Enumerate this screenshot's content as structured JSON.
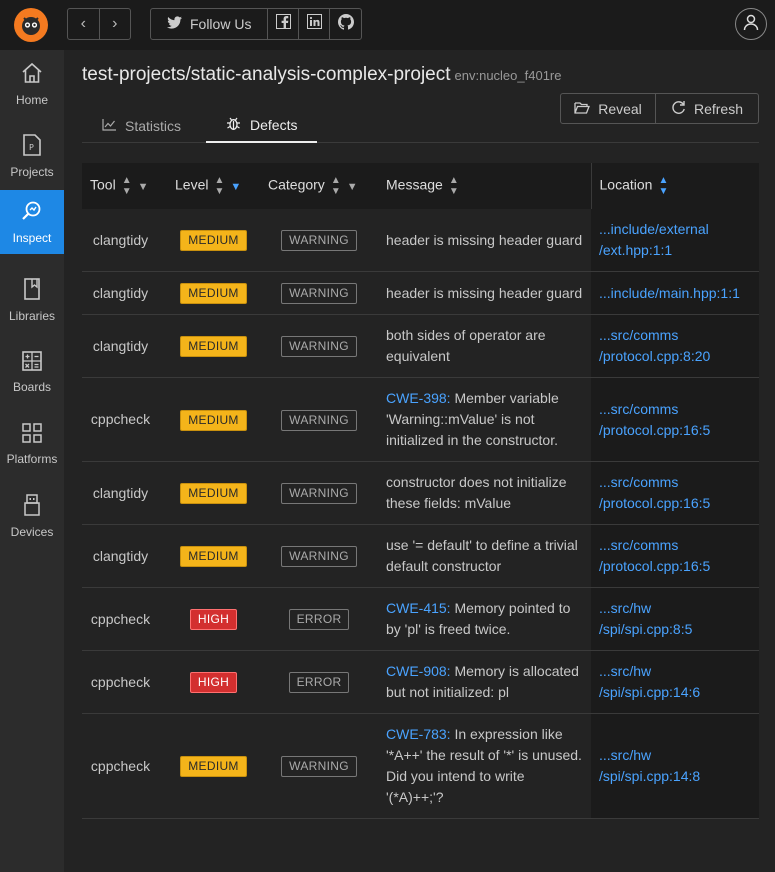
{
  "topbar": {
    "back_icon": "chevron-left-icon",
    "forward_icon": "chevron-right-icon",
    "follow_label": "Follow Us"
  },
  "sidebar": {
    "items": [
      {
        "label": "Home",
        "icon": "home-icon"
      },
      {
        "label": "Projects",
        "icon": "project-icon"
      },
      {
        "label": "Inspect",
        "icon": "inspect-icon"
      },
      {
        "label": "Libraries",
        "icon": "book-icon"
      },
      {
        "label": "Boards",
        "icon": "calculator-icon"
      },
      {
        "label": "Platforms",
        "icon": "grid-icon"
      },
      {
        "label": "Devices",
        "icon": "plug-icon"
      }
    ],
    "active": "Inspect"
  },
  "header": {
    "title": "test-projects/static-analysis-complex-project",
    "env": "env:nucleo_f401re",
    "reveal_label": "Reveal",
    "refresh_label": "Refresh"
  },
  "tabs": [
    {
      "label": "Statistics",
      "active": false
    },
    {
      "label": "Defects",
      "active": true
    }
  ],
  "table": {
    "headers": [
      "Tool",
      "Level",
      "Category",
      "Message",
      "Location"
    ],
    "rows": [
      {
        "tool": "clangtidy",
        "level": "MEDIUM",
        "category": "WARNING",
        "cwe": "",
        "message": "header is missing header guard",
        "loc1": "...include/external",
        "loc2": "/ext.hpp:1:1"
      },
      {
        "tool": "clangtidy",
        "level": "MEDIUM",
        "category": "WARNING",
        "cwe": "",
        "message": "header is missing header guard",
        "loc1": "...include/main.hpp:1:1",
        "loc2": ""
      },
      {
        "tool": "clangtidy",
        "level": "MEDIUM",
        "category": "WARNING",
        "cwe": "",
        "message": "both sides of operator are equivalent",
        "loc1": "...src/comms",
        "loc2": "/protocol.cpp:8:20"
      },
      {
        "tool": "cppcheck",
        "level": "MEDIUM",
        "category": "WARNING",
        "cwe": "CWE-398:",
        "message": "Member variable 'Warning::mValue' is not initialized in the constructor.",
        "loc1": "...src/comms",
        "loc2": "/protocol.cpp:16:5"
      },
      {
        "tool": "clangtidy",
        "level": "MEDIUM",
        "category": "WARNING",
        "cwe": "",
        "message": "constructor does not initialize these fields: mValue",
        "loc1": "...src/comms",
        "loc2": "/protocol.cpp:16:5"
      },
      {
        "tool": "clangtidy",
        "level": "MEDIUM",
        "category": "WARNING",
        "cwe": "",
        "message": "use '= default' to define a trivial default constructor",
        "loc1": "...src/comms",
        "loc2": "/protocol.cpp:16:5"
      },
      {
        "tool": "cppcheck",
        "level": "HIGH",
        "category": "ERROR",
        "cwe": "CWE-415:",
        "message": "Memory pointed to by 'pl' is freed twice.",
        "loc1": "...src/hw",
        "loc2": "/spi/spi.cpp:8:5"
      },
      {
        "tool": "cppcheck",
        "level": "HIGH",
        "category": "ERROR",
        "cwe": "CWE-908:",
        "message": "Memory is allocated but not initialized: pl",
        "loc1": "...src/hw",
        "loc2": "/spi/spi.cpp:14:6"
      },
      {
        "tool": "cppcheck",
        "level": "MEDIUM",
        "category": "WARNING",
        "cwe": "CWE-783:",
        "message": "In expression like '*A++' the result of '*' is unused. Did you intend to write '(*A)++;'?",
        "loc1": "...src/hw",
        "loc2": "/spi/spi.cpp:14:8"
      }
    ]
  }
}
